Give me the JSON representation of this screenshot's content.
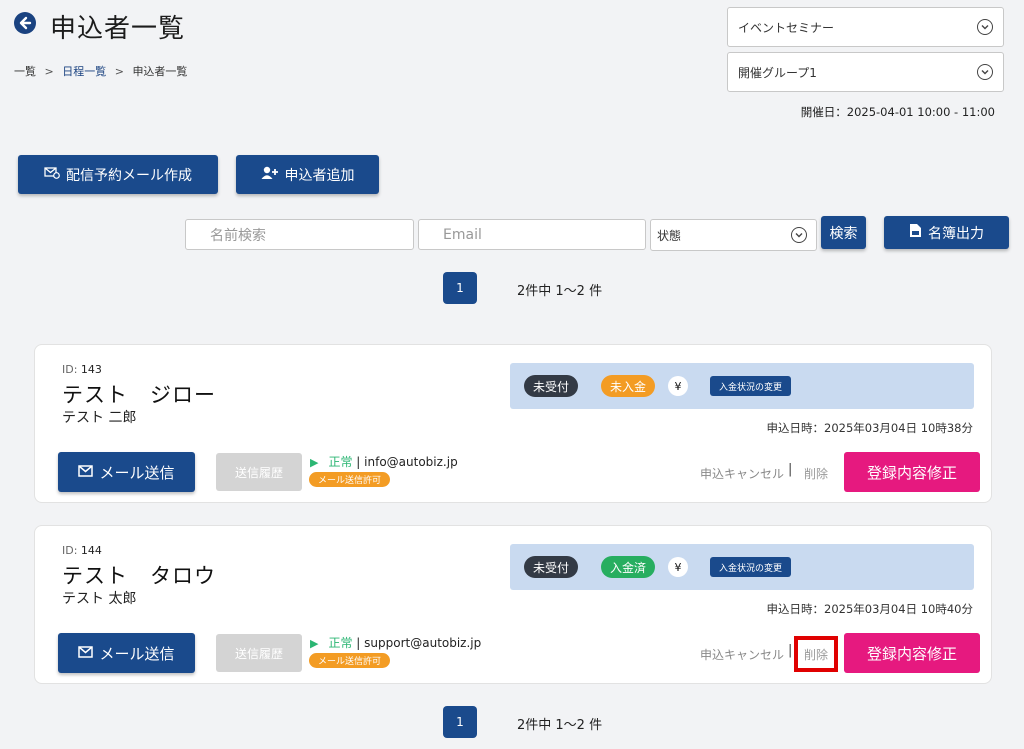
{
  "header": {
    "title": "申込者一覧",
    "breadcrumb": {
      "item1": "一覧",
      "item2": "日程一覧",
      "item3": "申込者一覧",
      "sep": ">"
    }
  },
  "selects": {
    "event": "イベントセミナー",
    "group": "開催グループ1"
  },
  "event_date": "開催日：2025-04-01 10:00 - 11:00",
  "actions": {
    "create_mail": "配信予約メール作成",
    "add_applicant": "申込者追加"
  },
  "search": {
    "name_placeholder": "名前検索",
    "email_placeholder": "Email",
    "status_label": "状態",
    "search_button": "検索",
    "export_button": "名簿出力"
  },
  "pagination": {
    "current": "1",
    "summary": "2件中 1〜2 件"
  },
  "applicants": [
    {
      "id_label": "ID:",
      "id": "143",
      "name": "テスト　ジロー",
      "kana": "テスト 二郎",
      "reception": "未受付",
      "payment": "未入金",
      "yen": "¥",
      "change_payment": "入金状況の変更",
      "applied_at": "申込日時：2025年03月04日 10時38分",
      "mail_button": "メール送信",
      "history_button": "送信履歴",
      "mail_status": "正常",
      "email": "info@autobiz.jp",
      "mail_permission": "メール送信許可",
      "cancel": "申込キャンセル",
      "separator": "|",
      "delete": "削除",
      "edit": "登録内容修正"
    },
    {
      "id_label": "ID:",
      "id": "144",
      "name": "テスト　タロウ",
      "kana": "テスト 太郎",
      "reception": "未受付",
      "payment": "入金済",
      "yen": "¥",
      "change_payment": "入金状況の変更",
      "applied_at": "申込日時：2025年03月04日 10時40分",
      "mail_button": "メール送信",
      "history_button": "送信履歴",
      "mail_status": "正常",
      "email": "support@autobiz.jp",
      "mail_permission": "メール送信許可",
      "cancel": "申込キャンセル",
      "separator": "|",
      "delete": "削除",
      "edit": "登録内容修正"
    }
  ],
  "colors": {
    "navy": "#1a4a8c",
    "pink": "#e6197f",
    "orange": "#f39c24",
    "green": "#27ae60",
    "highlight": "#e00000"
  }
}
